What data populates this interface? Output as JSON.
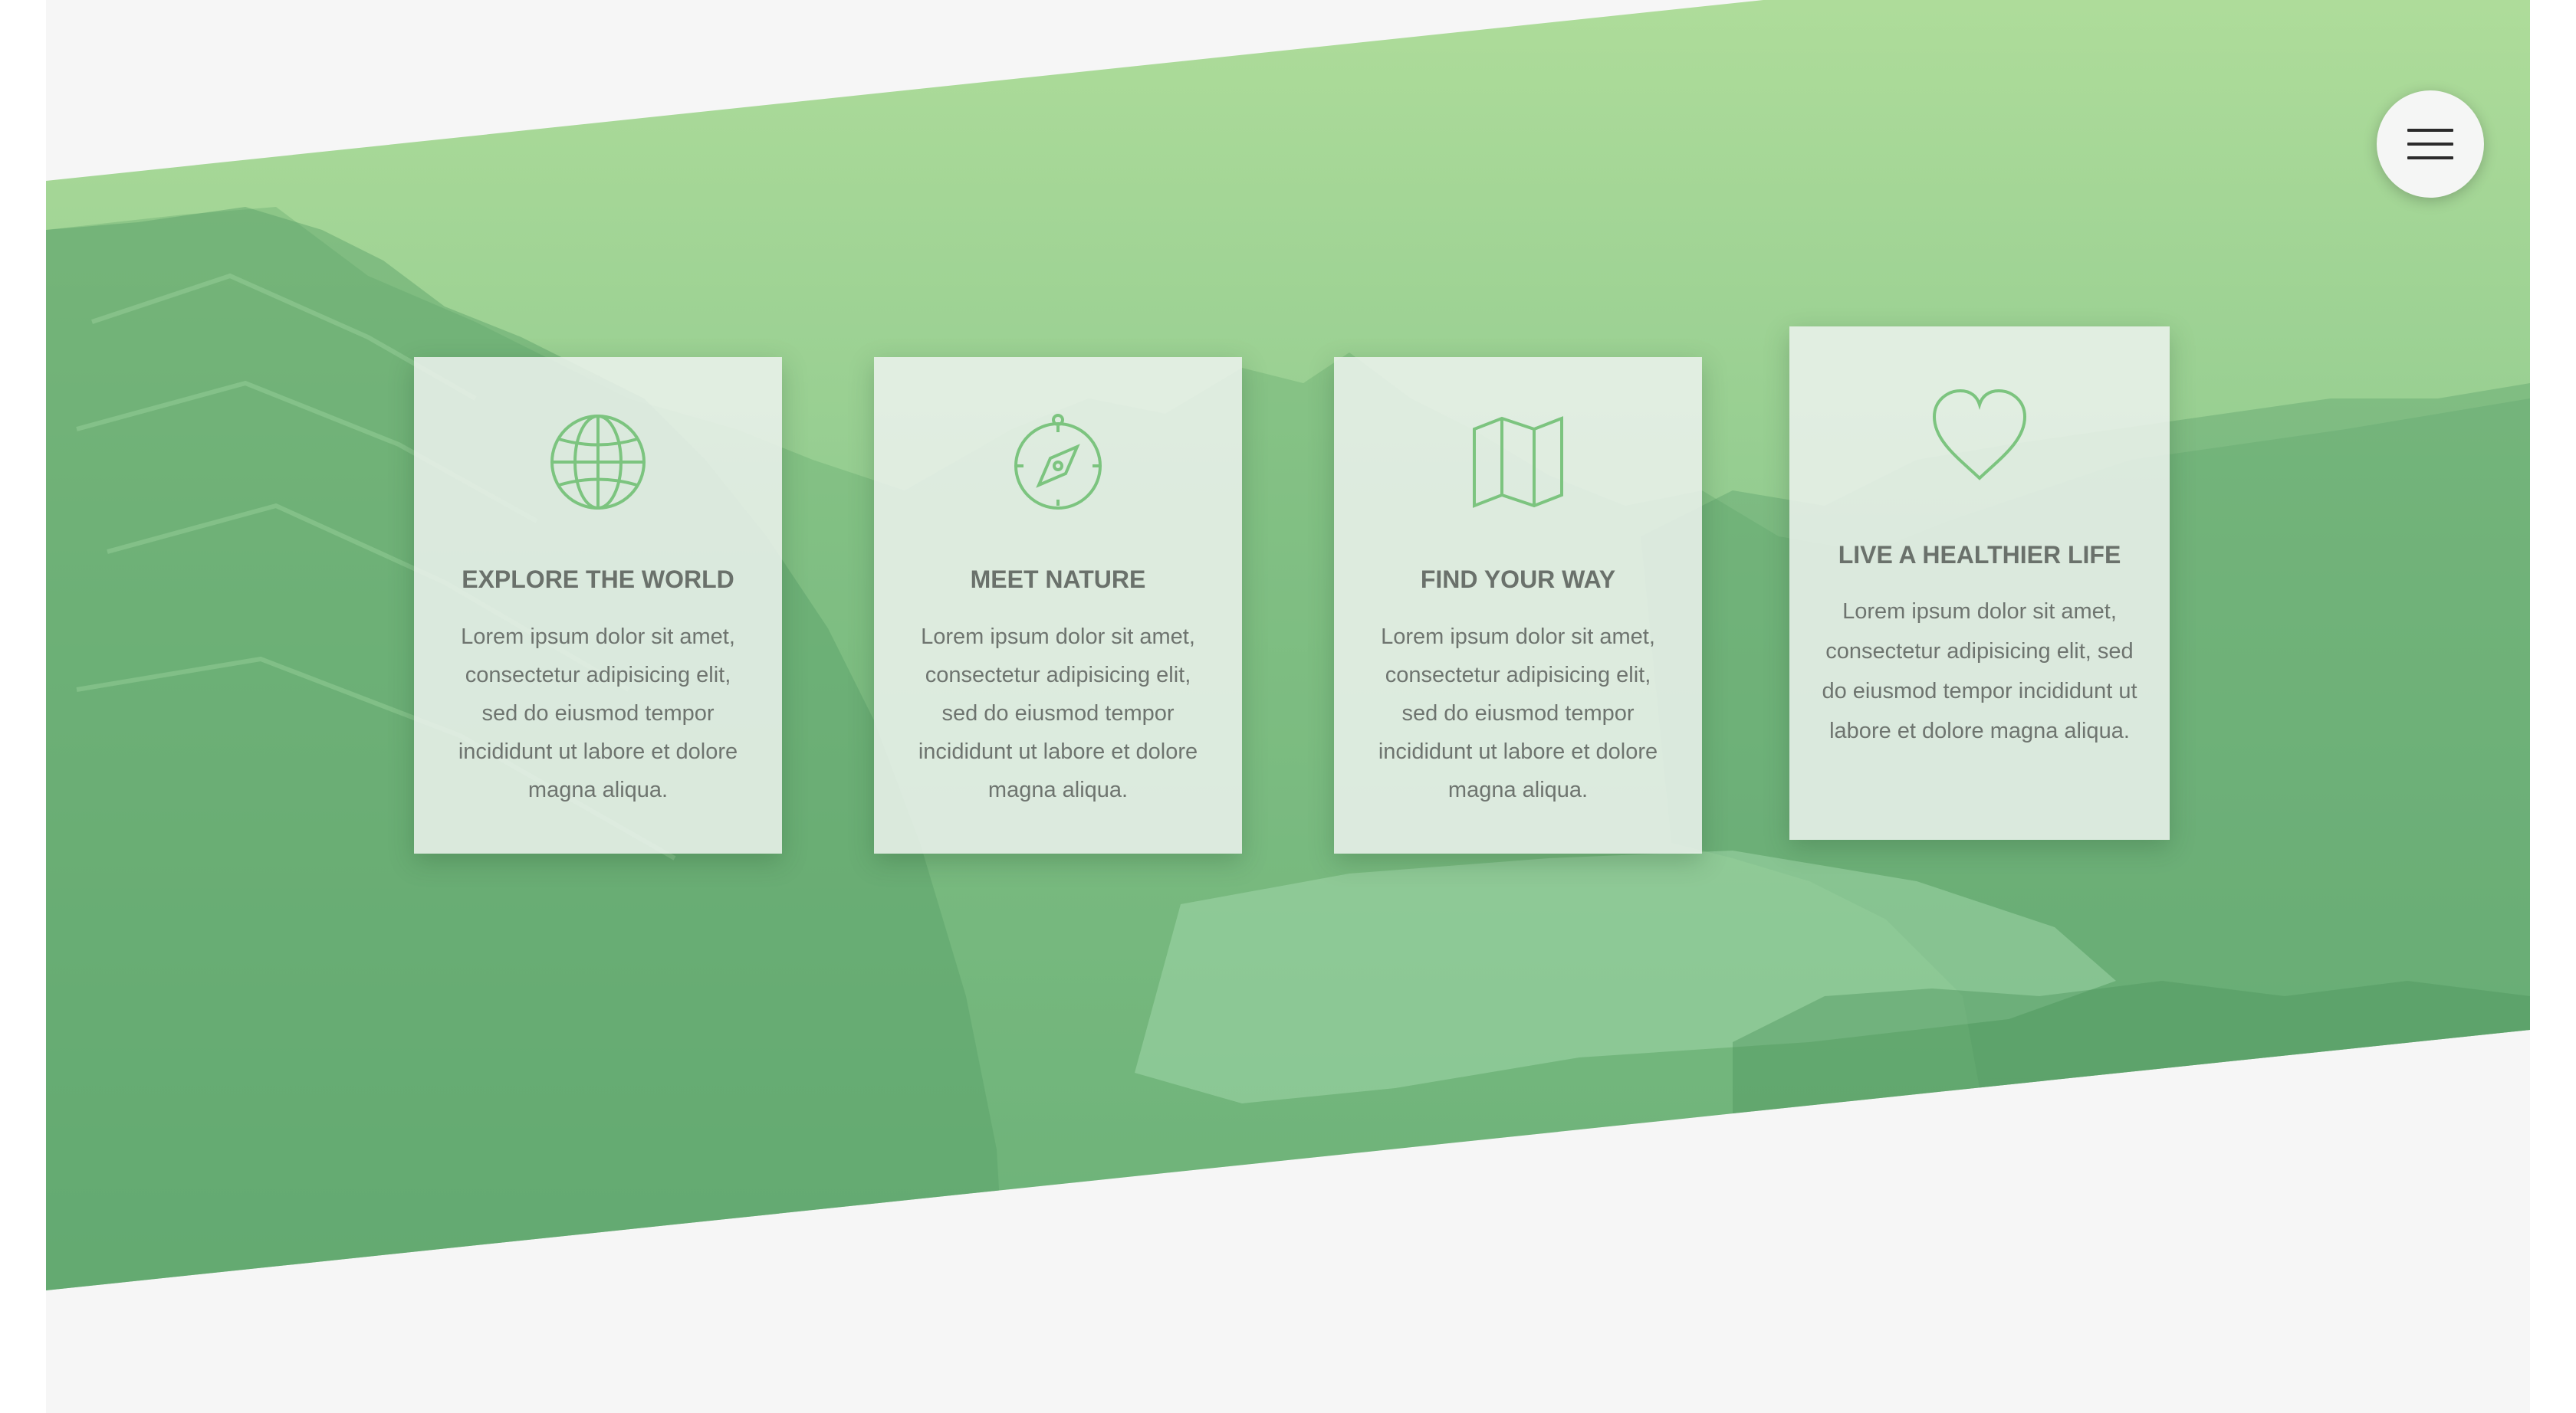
{
  "menu": {
    "icon": "hamburger-menu-icon"
  },
  "colors": {
    "accent": "#7cc47f",
    "hero_green": "#86c684",
    "page_background": "#f6f6f6",
    "card_background": "#ecf2ee",
    "title_text": "#6a716b",
    "body_text": "#6e746f"
  },
  "cards": [
    {
      "icon": "globe-icon",
      "title": "EXPLORE THE WORLD",
      "text": "Lorem ipsum dolor sit amet, consectetur adipisicing elit, sed do eiusmod tempor incididunt ut labore et dolore magna aliqua."
    },
    {
      "icon": "compass-icon",
      "title": "MEET NATURE",
      "text": "Lorem ipsum dolor sit amet, consectetur adipisicing elit, sed do eiusmod tempor incididunt ut labore et dolore magna aliqua."
    },
    {
      "icon": "map-icon",
      "title": "FIND YOUR WAY",
      "text": "Lorem ipsum dolor sit amet, consectetur adipisicing elit, sed do eiusmod tempor incididunt ut labore et dolore magna aliqua."
    },
    {
      "icon": "heart-icon",
      "title": "LIVE A HEALTHIER LIFE",
      "text": "Lorem ipsum dolor sit amet, consectetur adipisicing elit, sed do eiusmod tempor incididunt ut labore et dolore magna aliqua."
    }
  ]
}
